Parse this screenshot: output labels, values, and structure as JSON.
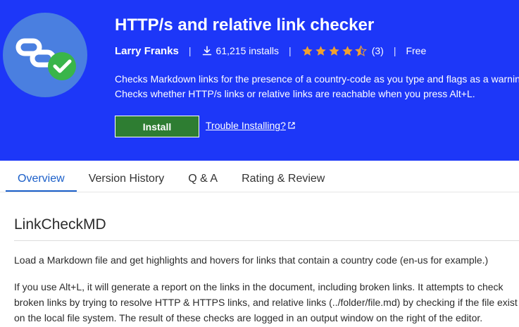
{
  "extension": {
    "title": "HTTP/s and relative link checker",
    "publisher": "Larry Franks",
    "installs": "61,215 installs",
    "rating_value": 4.5,
    "rating_count": "(3)",
    "price": "Free",
    "description_line1": "Checks Markdown links for the presence of a country-code as you type and flags as a warning",
    "description_line2": "Checks whether HTTP/s links or relative links are reachable when you press Alt+L.",
    "install_label": "Install",
    "trouble_label": "Trouble Installing?"
  },
  "tabs": [
    {
      "label": "Overview",
      "active": true
    },
    {
      "label": "Version History",
      "active": false
    },
    {
      "label": "Q & A",
      "active": false
    },
    {
      "label": "Rating & Review",
      "active": false
    }
  ],
  "content": {
    "heading": "LinkCheckMD",
    "paragraph1": "Load a Markdown file and get highlights and hovers for links that contain a country code (en-us for example.)",
    "paragraph2": "If you use Alt+L, it will generate a report on the links in the document, including broken links. It attempts to check broken links by trying to resolve HTTP & HTTPS links, and relative links (../folder/file.md) by checking if the file exist on the local file system. The result of these checks are logged in an output window on the right of the editor."
  },
  "icons": {
    "logo": "link-check-logo-icon",
    "download": "download-icon",
    "star": "star-icon",
    "external": "external-link-icon"
  },
  "colors": {
    "header_bg": "#1d37f8",
    "install_bg": "#2e7d32",
    "star": "#f0a030",
    "tab_active": "#1b5fc9"
  }
}
